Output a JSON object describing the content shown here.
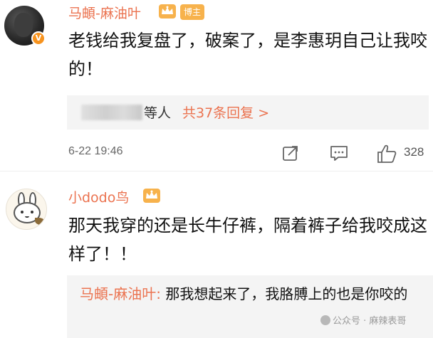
{
  "comments": [
    {
      "username": "马頔-麻油叶",
      "badge": "博主",
      "text": "老钱给我复盘了，破案了，是李惠玥自己让我咬的！",
      "reply_summary": {
        "suffix": "等人",
        "count_text": "共37条回复 >"
      },
      "timestamp": "6-22 19:46",
      "like_count": "328",
      "verified_mark": "V"
    },
    {
      "username": "小dodo鸟",
      "text": "那天我穿的还是长牛仔裤，隔着裤子给我咬成这样了！！",
      "nested_reply": {
        "author": "马頔-麻油叶:",
        "text": " 那我想起来了，我胳膊上的也是你咬的"
      }
    }
  ],
  "watermark": "公众号 · 麻辣表哥",
  "colors": {
    "username": "#eb7350",
    "badge_bg": "#f7b24c",
    "reply_bg": "#f4f4f4"
  },
  "icons": [
    "crown-icon",
    "share-icon",
    "comment-icon",
    "like-icon"
  ]
}
